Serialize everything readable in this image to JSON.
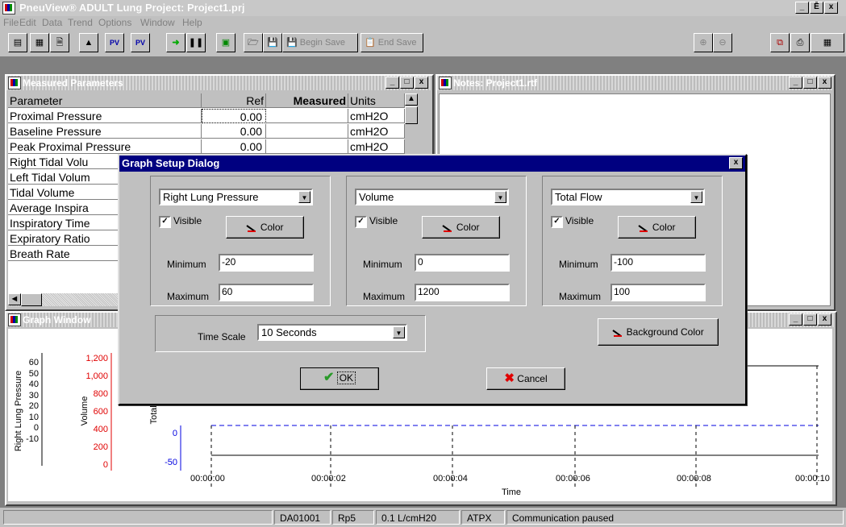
{
  "app": {
    "title": "PneuView® ADULT Lung Project: Project1.prj",
    "window_buttons": [
      "_",
      "Ē",
      "x"
    ]
  },
  "menu": [
    "File",
    "Edit",
    "Data",
    "Trend",
    "Options",
    "Window",
    "Help"
  ],
  "toolbar": {
    "begin_save": "Begin Save",
    "end_save": "End Save",
    "icon_labels": [
      "PV",
      "PV"
    ]
  },
  "measured_window": {
    "title": "Measured Parameters",
    "columns": [
      "Parameter",
      "Ref",
      "Measured",
      "Units"
    ],
    "rows": [
      [
        "Proximal Pressure",
        "0.00",
        "",
        "cmH2O"
      ],
      [
        "Baseline Pressure",
        "0.00",
        "",
        "cmH2O"
      ],
      [
        "Peak Proximal Pressure",
        "0.00",
        "",
        "cmH2O"
      ],
      [
        "Right Tidal Volu",
        "",
        "",
        ""
      ],
      [
        "Left Tidal Volum",
        "",
        "",
        ""
      ],
      [
        "Tidal Volume",
        "",
        "",
        ""
      ],
      [
        "Average Inspira",
        "",
        "",
        ""
      ],
      [
        "Inspiratory Time",
        "",
        "",
        ""
      ],
      [
        "Expiratory Ratio",
        "",
        "",
        ""
      ],
      [
        "Breath Rate",
        "",
        "",
        ""
      ]
    ]
  },
  "notes_window": {
    "title": "Notes: Project1.rtf"
  },
  "graph_window": {
    "title": "Graph Window",
    "left_axis_label": "Right Lung Pressure",
    "mid_axis_label": "Volume",
    "right_axis_label": "Total F",
    "left_ticks": [
      "60",
      "50",
      "40",
      "30",
      "20",
      "10",
      "0",
      "-10"
    ],
    "mid_ticks": [
      "1,200",
      "1,000",
      "800",
      "600",
      "400",
      "200",
      "0"
    ],
    "right_ticks": [
      "0",
      "-50"
    ],
    "time_ticks": [
      "00:00:00",
      "00:00:02",
      "00:00:04",
      "00:00:06",
      "00:00:08",
      "00:00:10"
    ],
    "x_label": "Time"
  },
  "dialog": {
    "title": "Graph Setup Dialog",
    "groups": [
      {
        "trace": "Right Lung Pressure",
        "visible_label": "Visible",
        "visible": true,
        "color_label": "Color",
        "min_label": "Minimum",
        "min": "-20",
        "max_label": "Maximum",
        "max": "60"
      },
      {
        "trace": "Volume",
        "visible_label": "Visible",
        "visible": true,
        "color_label": "Color",
        "min_label": "Minimum",
        "min": "0",
        "max_label": "Maximum",
        "max": "1200"
      },
      {
        "trace": "Total Flow",
        "visible_label": "Visible",
        "visible": true,
        "color_label": "Color",
        "min_label": "Minimum",
        "min": "-100",
        "max_label": "Maximum",
        "max": "100"
      }
    ],
    "time_scale_label": "Time Scale",
    "time_scale": "10 Seconds",
    "background_color": "Background Color",
    "ok": "OK",
    "cancel": "Cancel"
  },
  "status": [
    "DA01001",
    "Rp5",
    "0.1 L/cmH20",
    "ATPX",
    "Communication paused"
  ],
  "colors": {
    "dialog_title": "#000080",
    "ok_check": "#2a9a2a",
    "cancel_x": "#e00000",
    "volume_axis": "#e00000",
    "flow_axis": "#0000e0"
  }
}
